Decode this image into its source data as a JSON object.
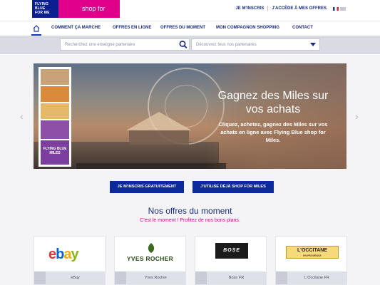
{
  "brand": {
    "logo_text": "FLYING BLUE FOR ME",
    "tagline": "shop for Miles",
    "colors": {
      "primary": "#0b2a9e",
      "accent": "#e0008a",
      "text": "#1a2a80"
    }
  },
  "top_links": {
    "signup": "JE M'INSCRIS",
    "access_offers": "J'ACCÈDE À MES OFFRES",
    "lang_fr_icon": "flag-fr-icon",
    "lang_en_icon": "flag-en-icon"
  },
  "nav": {
    "home_icon": "home-icon",
    "items": [
      {
        "label": "COMMENT ÇA MARCHE"
      },
      {
        "label": "OFFRES EN LIGNE"
      },
      {
        "label": "OFFRES DU MOMENT"
      },
      {
        "label": "MON COMPAGNON SHOPPING"
      },
      {
        "label": "CONTACT"
      }
    ]
  },
  "search": {
    "placeholder": "Recherchez une enseigne partenaire",
    "icon": "search-icon"
  },
  "partner_select": {
    "value": "Découvrez tous nos partenaires",
    "icon": "chevron-down-icon"
  },
  "hero": {
    "title": "Gagnez des Miles sur vos achats",
    "subtitle": "Cliquez, achetez, gagnez des Miles sur vos achats en ligne avec Flying Blue shop for Miles.",
    "card_label": "FLYING BLUE MILES",
    "prev_icon": "chevron-left-icon",
    "next_icon": "chevron-right-icon"
  },
  "cta": {
    "signup_free": "JE M'INSCRIS GRATUITEMENT",
    "already_use": "J'UTILISE DÉJÀ SHOP FOR MILES"
  },
  "offers_section": {
    "title": "Nos offres du moment",
    "subtitle": "C'est le moment ! Profitez de nos bons plans."
  },
  "offers": [
    {
      "name": "eBay",
      "logo_text": "ebay",
      "foot_icon": "monitor-icon"
    },
    {
      "name": "Yves Rocher",
      "logo_text": "YVES ROCHER",
      "foot_icon": "monitor-icon"
    },
    {
      "name": "Bose FR",
      "logo_text": "BOSE",
      "foot_icon": "calendar-icon"
    },
    {
      "name": "L'Occitane FR",
      "logo_text": "L'OCCITANE",
      "logo_subtext": "EN PROVENCE",
      "foot_icon": "calendar-icon"
    }
  ]
}
